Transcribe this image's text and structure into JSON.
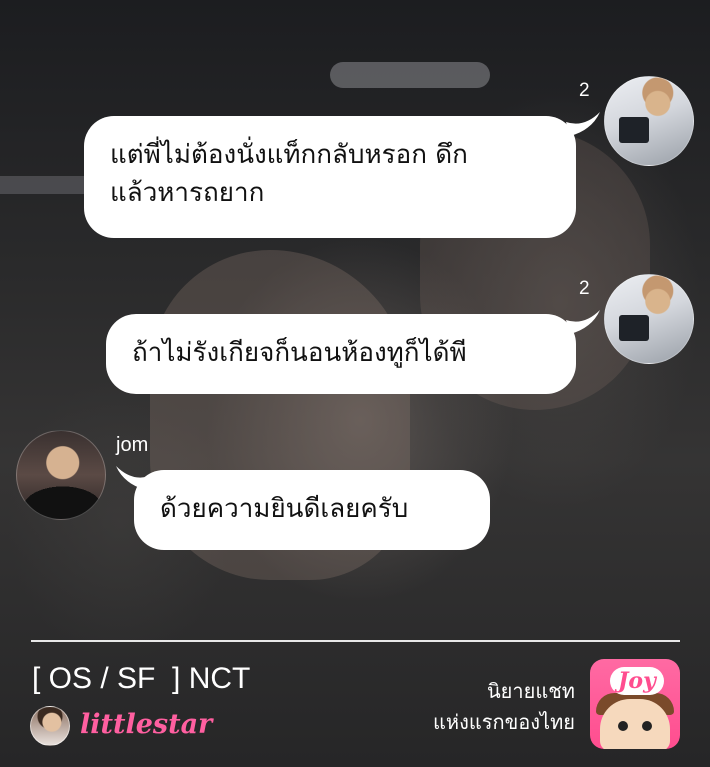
{
  "messages": [
    {
      "side": "right",
      "read_count": "2",
      "text_lines": [
        "แต่พี่ไม่ต้องนั่งแท็กกลับหรอก ดึก",
        "แล้วหารถยาก"
      ]
    },
    {
      "side": "right",
      "read_count": "2",
      "text_lines": [
        "ถ้าไม่รังเกียจก็นอนห้องทูก็ได้พี"
      ]
    },
    {
      "side": "left",
      "sender": "jom",
      "text_lines": [
        "ด้วยความยินดีเลยครับ"
      ]
    }
  ],
  "footer": {
    "title": "[ OS / SF  ] NCT",
    "author": "littlestar",
    "tagline_lines": [
      "นิยายแชท",
      "แห่งแรกของไทย"
    ],
    "logo_text": "Joy"
  },
  "colors": {
    "bubble": "#ffffff",
    "author_pink": "#ff5fa0",
    "logo_pink": "#ff4d8f"
  }
}
